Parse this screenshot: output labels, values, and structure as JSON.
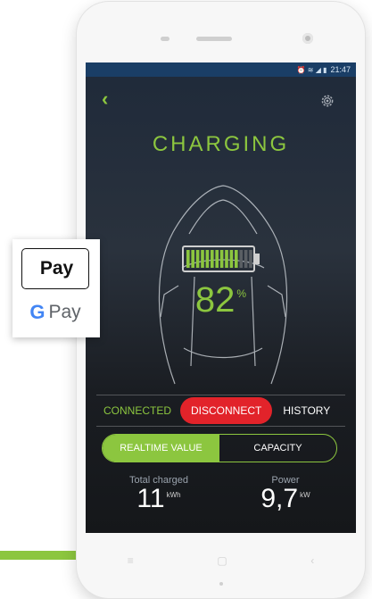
{
  "status_bar": {
    "time": "21:47",
    "icons": "⏰ ≋ ◢ ▮"
  },
  "header": {
    "title": "CHARGING"
  },
  "battery": {
    "percent": "82",
    "percent_unit": "%",
    "level": 0.82
  },
  "tabs": {
    "connected": "CONNECTED",
    "disconnect": "DISCONNECT",
    "history": "HISTORY"
  },
  "toggle": {
    "realtime": "REALTIME VALUE",
    "capacity": "CAPACITY"
  },
  "stats": {
    "total_charged": {
      "label": "Total charged",
      "value": "11",
      "unit": "kWh"
    },
    "power": {
      "label": "Power",
      "value": "9,7",
      "unit": "kW"
    }
  },
  "payment": {
    "apple_pay": "Pay",
    "google_pay": "Pay"
  },
  "colors": {
    "accent": "#8cc63f",
    "danger": "#e2232a",
    "status_bar": "#1a3e66"
  }
}
